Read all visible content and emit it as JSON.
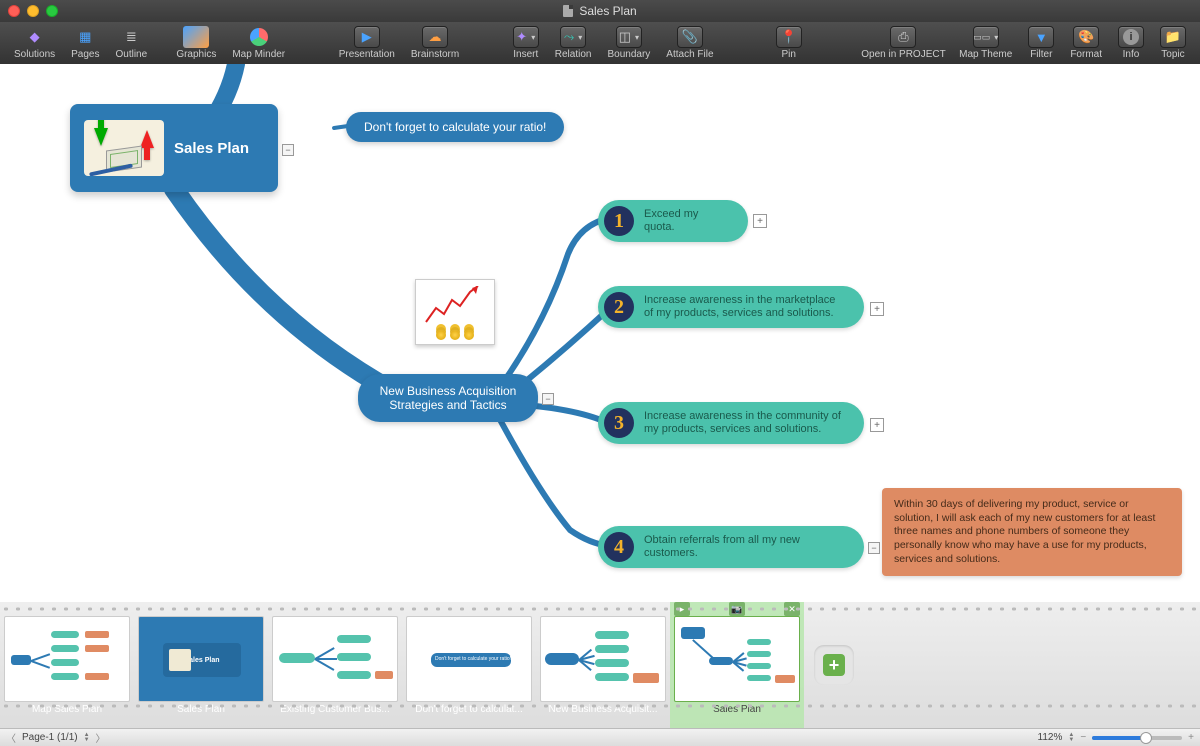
{
  "titlebar": {
    "title": "Sales Plan"
  },
  "toolbar": {
    "solutions": "Solutions",
    "pages": "Pages",
    "outline": "Outline",
    "graphics": "Graphics",
    "map_minder": "Map Minder",
    "presentation": "Presentation",
    "brainstorm": "Brainstorm",
    "insert": "Insert",
    "relation": "Relation",
    "boundary": "Boundary",
    "attach_file": "Attach File",
    "pin": "Pin",
    "open_in_project": "Open in PROJECT",
    "map_theme": "Map Theme",
    "filter": "Filter",
    "format": "Format",
    "info": "Info",
    "topic": "Topic"
  },
  "map": {
    "root": {
      "title": "Sales Plan"
    },
    "callout": {
      "text": "Don't forget to calculate your ratio!"
    },
    "hub": {
      "text": "New Business Acquisition Strategies and Tactics"
    },
    "goals": [
      {
        "num": "1",
        "text": "Exceed my quota."
      },
      {
        "num": "2",
        "text": "Increase awareness in the marketplace of my products, services and solutions."
      },
      {
        "num": "3",
        "text": "Increase awareness in the community of my products, services and solutions."
      },
      {
        "num": "4",
        "text": "Obtain referrals from all my new customers."
      }
    ],
    "note": {
      "text": "Within 30 days of delivering my product, service or solution, I will ask each of my new customers for at least three names and phone numbers of someone they personally know who may have a use for my products, services and solutions."
    }
  },
  "strip": {
    "slides": [
      {
        "caption": "Map Sales Plan"
      },
      {
        "caption": "Sales Plan"
      },
      {
        "caption": "Existing Customer Bus..."
      },
      {
        "caption": "Don't forget to calculat..."
      },
      {
        "caption": "New Business Acquisit..."
      },
      {
        "caption": "Sales Plan",
        "selected": true
      }
    ]
  },
  "status": {
    "page_label": "Page-1 (1/1)",
    "zoom": "112%"
  }
}
